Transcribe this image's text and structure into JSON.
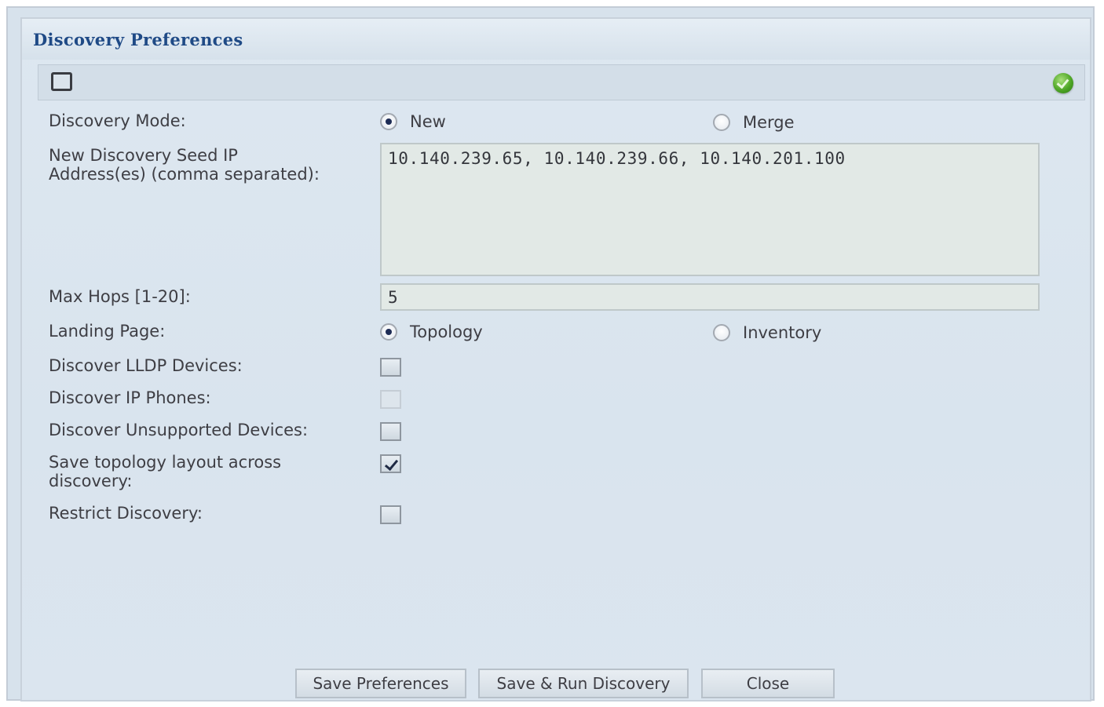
{
  "dialog": {
    "title": "Discovery Preferences"
  },
  "toolbar": {
    "checkbox_checked": false,
    "status_icon": "green-check-circle-icon"
  },
  "form": {
    "discovery_mode": {
      "label": "Discovery Mode:",
      "options": [
        {
          "label": "New",
          "selected": true
        },
        {
          "label": "Merge",
          "selected": false
        }
      ]
    },
    "seed_ip": {
      "label": "New Discovery Seed IP\nAddress(es) (comma separated):",
      "value": "10.140.239.65, 10.140.239.66, 10.140.201.100"
    },
    "max_hops": {
      "label": "Max Hops [1-20]:",
      "value": "5"
    },
    "landing_page": {
      "label": "Landing Page:",
      "options": [
        {
          "label": "Topology",
          "selected": true
        },
        {
          "label": "Inventory",
          "selected": false
        }
      ]
    },
    "discover_lldp": {
      "label": "Discover LLDP Devices:",
      "checked": false
    },
    "discover_ip_phones": {
      "label": "Discover IP Phones:",
      "checked": false,
      "disabled": true
    },
    "discover_unsupported": {
      "label": "Discover Unsupported Devices:",
      "checked": false
    },
    "save_topology_layout": {
      "label": "Save topology layout across\ndiscovery:",
      "checked": true
    },
    "restrict_discovery": {
      "label": "Restrict Discovery:",
      "checked": false
    }
  },
  "buttons": {
    "save_preferences": "Save Preferences",
    "save_and_run": "Save & Run Discovery",
    "close": "Close"
  },
  "colors": {
    "title": "#1f4a86",
    "background": "#d9e4ee",
    "status_green": "#4ea626"
  }
}
